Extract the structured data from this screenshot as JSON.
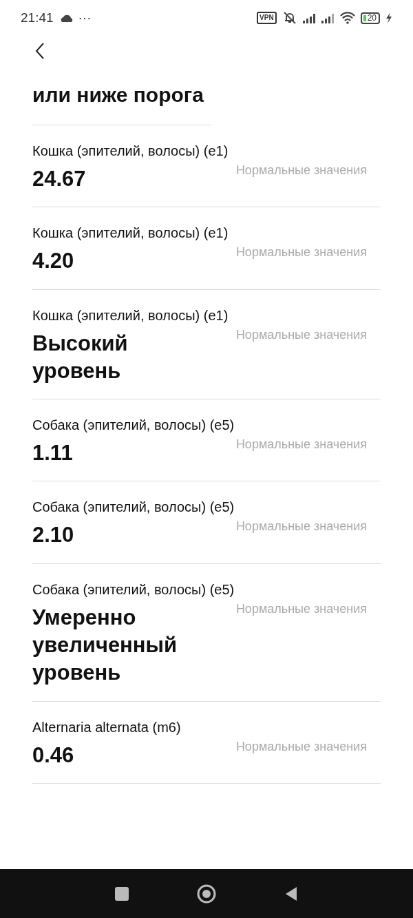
{
  "status_bar": {
    "time": "21:41",
    "more": "···",
    "vpn": "VPN",
    "battery": "20"
  },
  "previous_value": "или ниже порога",
  "results": [
    {
      "name": "Кошка (эпителий, волосы) (e1)",
      "note": "Нормальные значения",
      "value": "24.67"
    },
    {
      "name": "Кошка (эпителий, волосы) (e1)",
      "note": "Нормальные значения",
      "value": "4.20"
    },
    {
      "name": "Кошка (эпителий, волосы) (e1)",
      "note": "Нормальные значения",
      "value": "Высокий уровень"
    },
    {
      "name": "Собака (эпителий, волосы) (e5)",
      "note": "Нормальные значения",
      "value": "1.11"
    },
    {
      "name": "Собака (эпителий, волосы) (e5)",
      "note": "Нормальные значения",
      "value": "2.10"
    },
    {
      "name": "Собака (эпителий, волосы) (e5)",
      "note": "Нормальные значения",
      "value": "Умеренно увеличенный уровень"
    },
    {
      "name": "Alternaria alternata (m6)",
      "note": "Нормальные значения",
      "value": "0.46"
    }
  ]
}
